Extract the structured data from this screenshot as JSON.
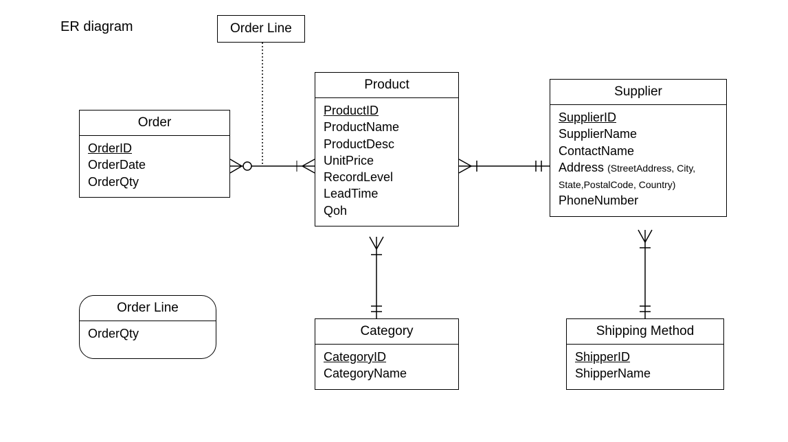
{
  "diagram": {
    "title": "ER diagram",
    "associativeLabel": "Order Line",
    "entities": {
      "order": {
        "name": "Order",
        "pk": "OrderID",
        "attrs": [
          "OrderDate",
          "OrderQty"
        ]
      },
      "product": {
        "name": "Product",
        "pk": "ProductID",
        "attrs": [
          "ProductName",
          "ProductDesc",
          "UnitPrice",
          "RecordLevel",
          "LeadTime",
          "Qoh"
        ]
      },
      "supplier": {
        "name": "Supplier",
        "pk": "SupplierID",
        "attrs_pre": [
          "SupplierName",
          "ContactName"
        ],
        "addressLabel": "Address",
        "addressComposite": "(StreetAddress, City, State,PostalCode, Country)",
        "attrs_post": [
          "PhoneNumber"
        ]
      },
      "category": {
        "name": "Category",
        "pk": "CategoryID",
        "attrs": [
          "CategoryName"
        ]
      },
      "shipping": {
        "name": "Shipping Method",
        "pk": "ShipperID",
        "attrs": [
          "ShipperName"
        ]
      },
      "orderline": {
        "name": "Order Line",
        "attrs": [
          "OrderQty"
        ]
      }
    }
  }
}
